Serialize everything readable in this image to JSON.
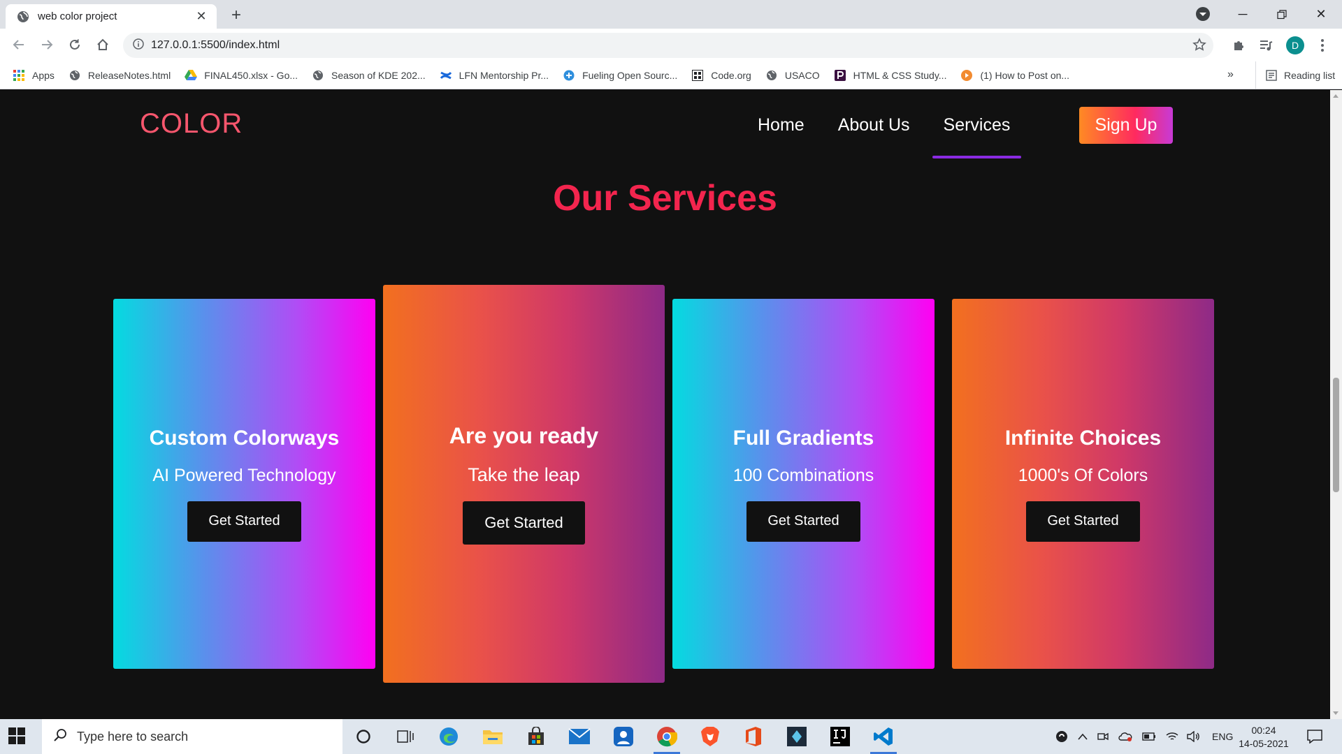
{
  "browser": {
    "tab_title": "web color project",
    "url": "127.0.0.1:5500/index.html",
    "profile_initial": "D",
    "bookmarks": [
      {
        "label": "Apps",
        "icon": "apps-grid-icon"
      },
      {
        "label": "ReleaseNotes.html",
        "icon": "globe-icon"
      },
      {
        "label": "FINAL450.xlsx - Go...",
        "icon": "google-drive-icon"
      },
      {
        "label": "Season of KDE 202...",
        "icon": "globe-icon"
      },
      {
        "label": "LFN Mentorship Pr...",
        "icon": "confluence-icon"
      },
      {
        "label": "Fueling Open Sourc...",
        "icon": "fueling-icon"
      },
      {
        "label": "Code.org",
        "icon": "code-org-icon"
      },
      {
        "label": "USACO",
        "icon": "globe-icon"
      },
      {
        "label": "HTML & CSS Study...",
        "icon": "p-icon"
      },
      {
        "label": "(1) How to Post on...",
        "icon": "play-icon"
      }
    ],
    "bookmarks_overflow": "»",
    "reading_list": "Reading list"
  },
  "site": {
    "logo": "COLOR",
    "nav": {
      "home": "Home",
      "about": "About Us",
      "services": "Services",
      "signup": "Sign Up"
    },
    "section_title": "Our Services",
    "cards": [
      {
        "title": "Custom Colorways",
        "subtitle": "AI Powered Technology",
        "button": "Get Started"
      },
      {
        "title": "Are you ready",
        "subtitle": "Take the leap",
        "button": "Get Started"
      },
      {
        "title": "Full Gradients",
        "subtitle": "100 Combinations",
        "button": "Get Started"
      },
      {
        "title": "Infinite Choices",
        "subtitle": "1000's Of Colors",
        "button": "Get Started"
      }
    ]
  },
  "taskbar": {
    "search_placeholder": "Type here to search",
    "language": "ENG",
    "time": "00:24",
    "date": "14-05-2021"
  },
  "colors": {
    "logo": "#f6566d",
    "section_title": "#f3254e",
    "active_underline": "#8a2be2",
    "page_background": "#111111"
  }
}
